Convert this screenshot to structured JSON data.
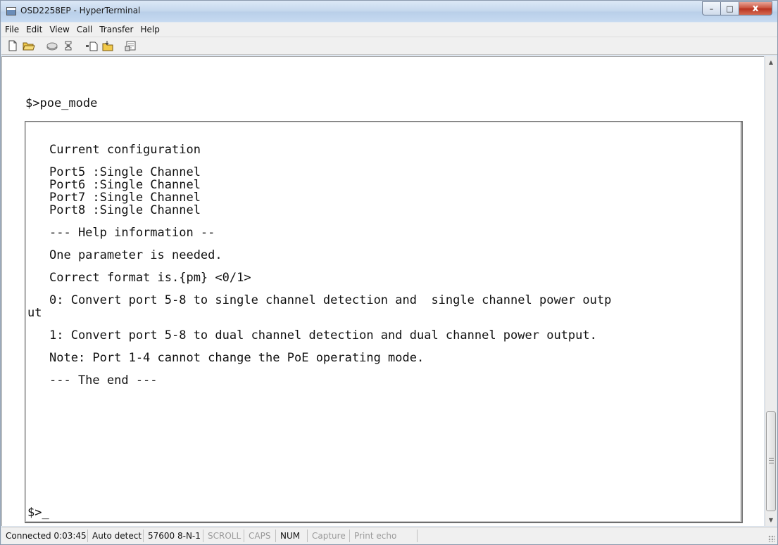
{
  "window": {
    "title": "OSD2258EP - HyperTerminal",
    "controls": {
      "minimize": "–",
      "maximize": "□",
      "close": "x"
    }
  },
  "menu": [
    "File",
    "Edit",
    "View",
    "Call",
    "Transfer",
    "Help"
  ],
  "toolbar": {
    "buttons": [
      "new-icon",
      "open-icon",
      "connect-icon",
      "disconnect-icon",
      "send-icon",
      "receive-icon",
      "properties-icon"
    ]
  },
  "terminal": {
    "prompt_command": "$>poe_mode",
    "lines": [
      "Current configuration",
      "",
      "Port5 :Single Channel",
      "Port6 :Single Channel",
      "Port7 :Single Channel",
      "Port8 :Single Channel",
      "",
      "--- Help information --",
      "",
      "One parameter is needed.",
      "",
      "Correct format is.{pm} <0/1>",
      "",
      "0: Convert port 5-8 to single channel detection and  single channel power outp",
      "ut",
      "",
      "1: Convert port 5-8 to dual channel detection and dual channel power output.",
      "",
      "Note: Port 1-4 cannot change the PoE operating mode.",
      "",
      "--- The end ---"
    ],
    "final_prompt": "$>_"
  },
  "statusbar": {
    "connected": "Connected 0:03:45",
    "detect": "Auto detect",
    "settings": "57600 8-N-1",
    "scroll": "SCROLL",
    "caps": "CAPS",
    "num": "NUM",
    "capture": "Capture",
    "print_echo": "Print echo"
  }
}
